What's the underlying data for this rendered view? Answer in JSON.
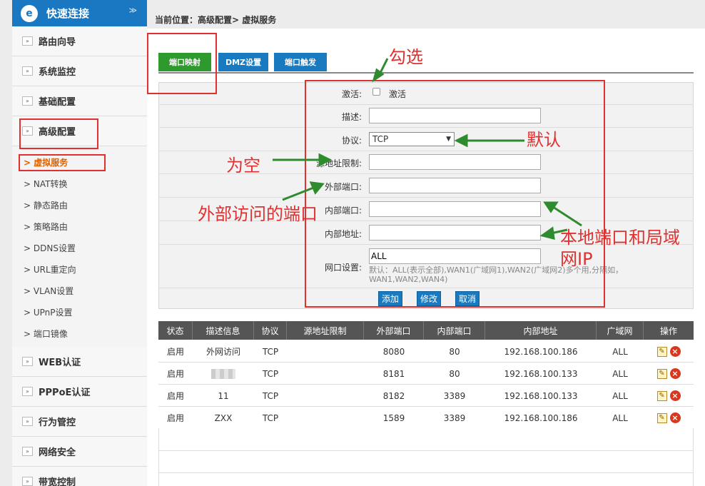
{
  "sidebar": {
    "title": "快速连接",
    "collapse_glyph": "≫",
    "groups": [
      {
        "label": "路由向导"
      },
      {
        "label": "系统监控"
      },
      {
        "label": "基础配置"
      },
      {
        "label": "高级配置"
      },
      {
        "label": "WEB认证"
      },
      {
        "label": "PPPoE认证"
      },
      {
        "label": "行为管控"
      },
      {
        "label": "网络安全"
      },
      {
        "label": "带宽控制"
      }
    ],
    "subitems": [
      {
        "label": "> 虚拟服务",
        "active": true
      },
      {
        "label": "> NAT转换"
      },
      {
        "label": "> 静态路由"
      },
      {
        "label": "> 策略路由"
      },
      {
        "label": "> DDNS设置"
      },
      {
        "label": "> URL重定向"
      },
      {
        "label": "> VLAN设置"
      },
      {
        "label": "> UPnP设置"
      },
      {
        "label": "> 端口镜像"
      }
    ]
  },
  "breadcrumb": "当前位置：高级配置> 虚拟服务",
  "tabs": [
    {
      "label": "端口映射",
      "color": "#2e9a2e"
    },
    {
      "label": "DMZ设置",
      "color": "#1a7ac0"
    },
    {
      "label": "端口触发",
      "color": "#1a7ac0"
    }
  ],
  "form": {
    "activate_label": "激活:",
    "activate_text": "激活",
    "desc_label": "描述:",
    "protocol_label": "协议:",
    "protocol_value": "TCP",
    "src_label": "源地址限制:",
    "ext_port_label": "外部端口:",
    "int_port_label": "内部端口:",
    "int_addr_label": "内部地址:",
    "wan_label": "网口设置:",
    "wan_value": "ALL",
    "wan_note": "默认：ALL(表示全部),WAN1(广域网1),WAN2(广域网2)多个用,分隔如，WAN1,WAN2,WAN4)",
    "btn_add": "添加",
    "btn_modify": "修改",
    "btn_cancel": "取消"
  },
  "table": {
    "headers": [
      "状态",
      "描述信息",
      "协议",
      "源地址限制",
      "外部端口",
      "内部端口",
      "内部地址",
      "广域网",
      "操作"
    ],
    "rows": [
      {
        "status": "启用",
        "desc": "外网访问",
        "proto": "TCP",
        "src": "",
        "ext": "8080",
        "int": "80",
        "addr": "192.168.100.186",
        "wan": "ALL"
      },
      {
        "status": "启用",
        "desc": "",
        "proto": "TCP",
        "src": "",
        "ext": "8181",
        "int": "80",
        "addr": "192.168.100.133",
        "wan": "ALL"
      },
      {
        "status": "启用",
        "desc": "11",
        "proto": "TCP",
        "src": "",
        "ext": "8182",
        "int": "3389",
        "addr": "192.168.100.133",
        "wan": "ALL"
      },
      {
        "status": "启用",
        "desc": "ZXX",
        "proto": "TCP",
        "src": "",
        "ext": "1589",
        "int": "3389",
        "addr": "192.168.100.186",
        "wan": "ALL"
      }
    ]
  },
  "annotations": {
    "check": "勾选",
    "default": "默认",
    "empty": "为空",
    "ext_port": "外部访问的端口",
    "local": "本地端口和局域网IP"
  },
  "colors": {
    "annotation": "#e03030",
    "arrow": "#2e8b2e"
  }
}
